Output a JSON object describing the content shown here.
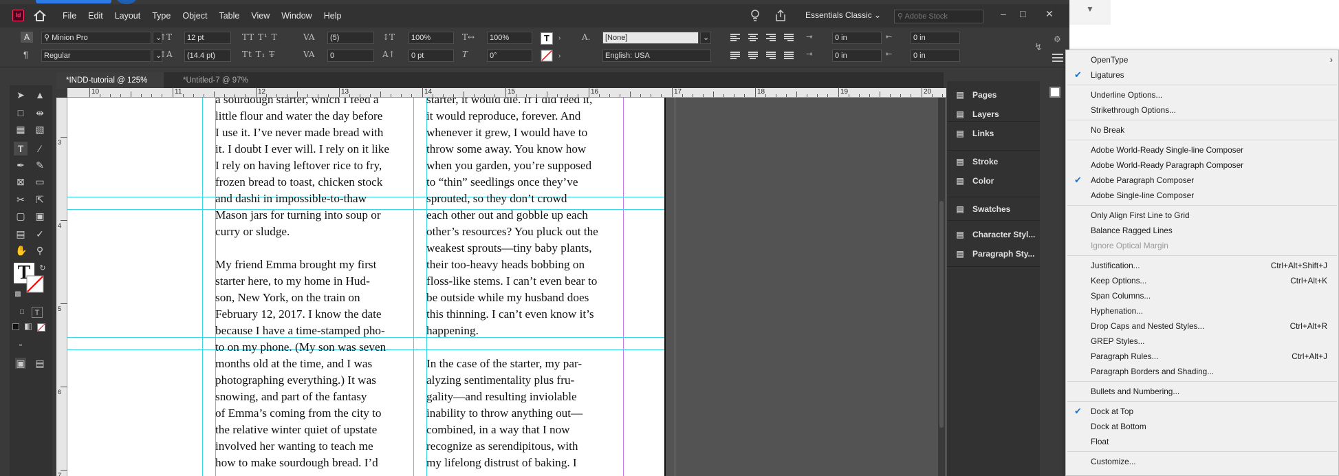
{
  "app": {
    "logo_text": "Id",
    "menu": [
      "File",
      "Edit",
      "Layout",
      "Type",
      "Object",
      "Table",
      "View",
      "Window",
      "Help"
    ],
    "workspace": "Essentials Classic",
    "stock_placeholder": "Adobe Stock"
  },
  "control": {
    "font_family": "Minion Pro",
    "font_style": "Regular",
    "font_size": "12 pt",
    "leading": "(14.4 pt)",
    "kerning": "(5)",
    "tracking": "0",
    "vscale": "100%",
    "hscale": "100%",
    "baseline": "0 pt",
    "skew": "0°",
    "char_style": "[None]",
    "language": "English: USA",
    "indent_left": "0 in",
    "indent_right": "0 in",
    "first_indent": "0 in",
    "last_indent": "0 in"
  },
  "tabs": [
    {
      "label": "*INDD-tutorial @ 125%"
    },
    {
      "label": "*Untitled-7 @ 97%"
    }
  ],
  "ruler_h": [
    "10",
    "11",
    "12",
    "13",
    "14",
    "15",
    "16",
    "17",
    "18",
    "19",
    "20"
  ],
  "ruler_v": [
    "3",
    "4",
    "5",
    "6",
    "7"
  ],
  "doc": {
    "col1": [
      "a sourdough starter, which I feed a",
      "little flour and water the day before",
      "I use it. I’ve never made bread with",
      "it. I doubt I ever will. I rely on it like",
      "I rely on having leftover rice to fry,",
      "frozen bread to toast, chicken stock",
      "and dashi in impossible-to-thaw",
      "Mason jars for turning into soup or",
      "curry or sludge.",
      "",
      "My friend Emma brought my first",
      "starter here, to my home in Hud-",
      "son, New York, on the train on",
      "February 12, 2017. I know the date",
      "because I have a time-stamped pho-",
      "to on my phone. (My son was seven",
      "months old at the time, and I was",
      "photographing everything.) It was",
      "snowing, and part of the fantasy",
      "of Emma’s coming from the city to",
      "the relative winter quiet of upstate",
      "involved her wanting to teach me",
      "how to make sourdough bread. I’d"
    ],
    "col2": [
      "starter, it would die. If I did feed it,",
      "it would reproduce, forever. And",
      "whenever it grew, I would have to",
      "throw some away. You know how",
      "when you garden, you’re supposed",
      "to “thin” seedlings once they’ve",
      "sprouted, so they don’t crowd",
      "each other out and gobble up each",
      "other’s resources? You pluck out the",
      "weakest sprouts—tiny baby plants,",
      "their too-heavy heads bobbing on",
      "floss-like stems. I can’t even bear to",
      "be outside while my husband does",
      "this thinning. I can’t even know it’s",
      "happening.",
      "",
      "In the case of the starter, my par-",
      "alyzing sentimentality plus fru-",
      "gality—and resulting inviolable",
      "inability to throw anything out—",
      "combined, in a way that I now",
      "recognize as serendipitous, with",
      "my lifelong distrust of baking. I"
    ]
  },
  "panels": [
    {
      "label": "Pages",
      "icon": "pages-icon"
    },
    {
      "label": "Layers",
      "icon": "layers-icon"
    },
    {
      "label": "Links",
      "icon": "links-icon"
    },
    {
      "label": "Stroke",
      "icon": "stroke-icon"
    },
    {
      "label": "Color",
      "icon": "color-icon"
    },
    {
      "label": "Swatches",
      "icon": "swatches-icon"
    },
    {
      "label": "Character Styl...",
      "icon": "character-styles-icon"
    },
    {
      "label": "Paragraph Sty...",
      "icon": "paragraph-styles-icon"
    }
  ],
  "flyout": [
    {
      "label": "OpenType",
      "submenu": true
    },
    {
      "label": "Ligatures",
      "checked": true
    },
    {
      "sep": true
    },
    {
      "label": "Underline Options..."
    },
    {
      "label": "Strikethrough Options..."
    },
    {
      "sep": true
    },
    {
      "label": "No Break"
    },
    {
      "sep": true
    },
    {
      "label": "Adobe World-Ready Single-line Composer"
    },
    {
      "label": "Adobe World-Ready Paragraph Composer"
    },
    {
      "label": "Adobe Paragraph Composer",
      "checked": true
    },
    {
      "label": "Adobe Single-line Composer"
    },
    {
      "sep": true
    },
    {
      "label": "Only Align First Line to Grid"
    },
    {
      "label": "Balance Ragged Lines"
    },
    {
      "label": "Ignore Optical Margin",
      "disabled": true
    },
    {
      "sep": true
    },
    {
      "label": "Justification...",
      "shortcut": "Ctrl+Alt+Shift+J"
    },
    {
      "label": "Keep Options...",
      "shortcut": "Ctrl+Alt+K"
    },
    {
      "label": "Span Columns..."
    },
    {
      "label": "Hyphenation..."
    },
    {
      "label": "Drop Caps and Nested Styles...",
      "shortcut": "Ctrl+Alt+R"
    },
    {
      "label": "GREP Styles..."
    },
    {
      "label": "Paragraph Rules...",
      "shortcut": "Ctrl+Alt+J"
    },
    {
      "label": "Paragraph Borders and Shading..."
    },
    {
      "sep": true
    },
    {
      "label": "Bullets and Numbering..."
    },
    {
      "sep": true
    },
    {
      "label": "Dock at Top",
      "checked": true
    },
    {
      "label": "Dock at Bottom"
    },
    {
      "label": "Float"
    },
    {
      "sep": true
    },
    {
      "label": "Customize..."
    }
  ]
}
